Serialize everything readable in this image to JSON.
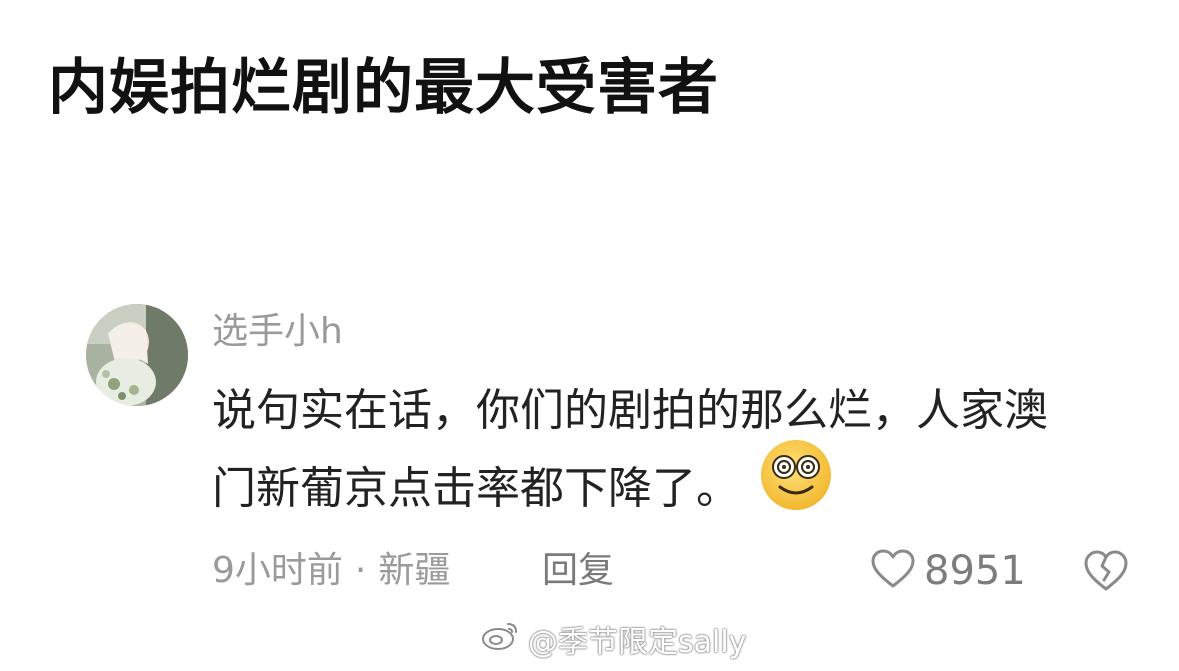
{
  "headline": "内娱拍烂剧的最大受害者",
  "comment": {
    "username": "选手小h",
    "lines": [
      "说句实在话，你们的剧拍的那么烂，人家澳",
      "门新葡京点击率都下降了。"
    ],
    "emoji": "smiling-face-emoji",
    "meta": {
      "time": "9小时前",
      "separator": "·",
      "location": "新疆"
    },
    "reply_label": "回复",
    "like_count": "8951"
  },
  "watermark": {
    "text": "@季节限定sally"
  },
  "colors": {
    "headline": "#111111",
    "username": "#9a9a9a",
    "comment_text": "#222222",
    "meta_text": "#9a9a9a",
    "emoji_yellow": "#f7c944"
  }
}
